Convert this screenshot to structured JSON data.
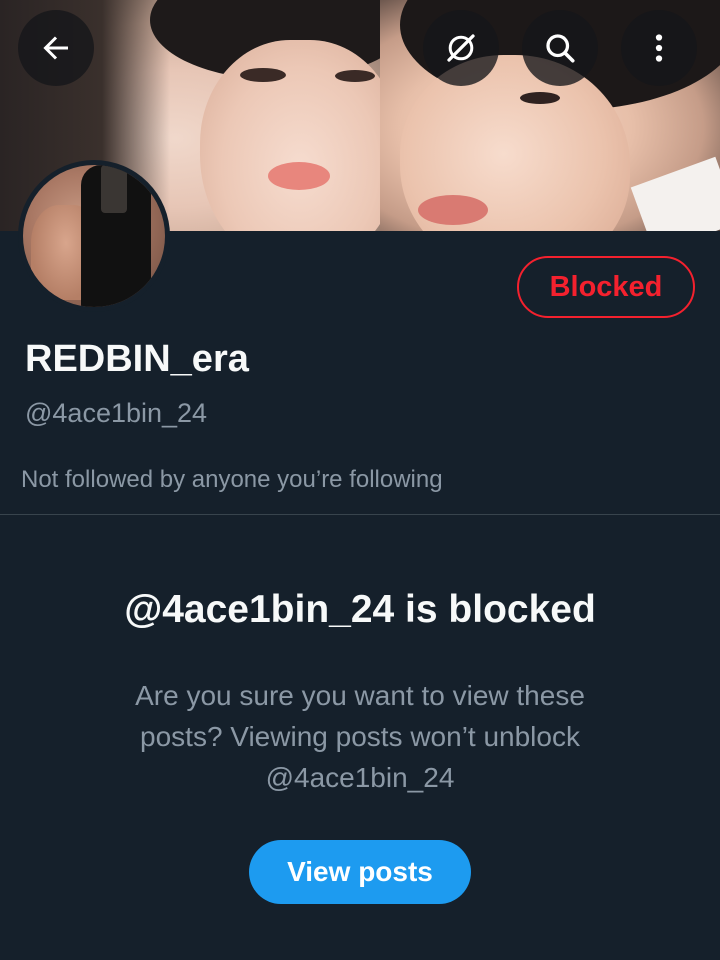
{
  "profile": {
    "display_name": "REDBIN_era",
    "handle": "@4ace1bin_24",
    "followed_by": "Not followed by anyone you’re following",
    "blocked_label": "Blocked"
  },
  "toolbar": {
    "back_icon": "back-arrow-icon",
    "grok_icon": "grok-icon",
    "search_icon": "search-icon",
    "more_icon": "more-vertical-icon"
  },
  "blocked_notice": {
    "title": "@4ace1bin_24 is blocked",
    "line1": "Are you sure you want to view these",
    "line2": "posts? Viewing posts won’t unblock",
    "line3": "@4ace1bin_24",
    "view_posts_label": "View posts"
  },
  "colors": {
    "background": "#15202b",
    "blocked_red": "#f4212e",
    "accent_blue": "#1d9bf0",
    "secondary_text": "#8b98a5"
  }
}
